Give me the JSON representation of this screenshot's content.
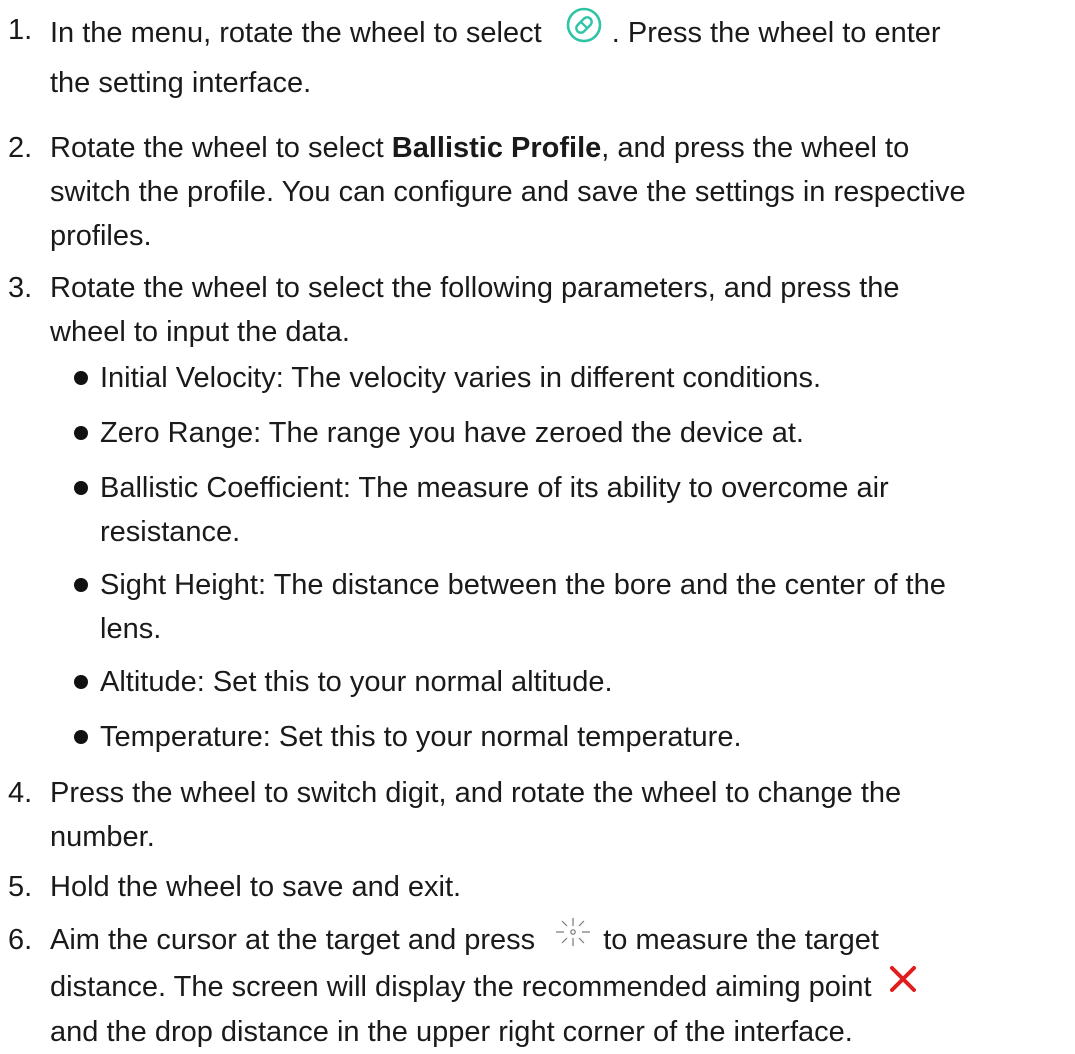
{
  "steps": [
    {
      "num": "1.",
      "a": "In the menu, rotate the wheel to select",
      "b": ". Press the wheel to enter",
      "c": "the setting interface.",
      "icon": "ballistic-settings-icon"
    },
    {
      "num": "2.",
      "a": "Rotate the wheel to select",
      "bold": "Ballistic Profile",
      "b": ", and press the wheel to",
      "c": "switch the profile. You can configure and save the settings in respective",
      "d": "profiles."
    },
    {
      "num": "3.",
      "a": "Rotate the wheel to select the following parameters, and press the",
      "b": "wheel to input the data."
    },
    {
      "num": "4.",
      "a": "Press the wheel to switch digit, and rotate the wheel to change the",
      "b": "number."
    },
    {
      "num": "5.",
      "a": "Hold the wheel to save and exit."
    },
    {
      "num": "6.",
      "a": "Aim the cursor at the target and press",
      "b": "to measure the target",
      "c": "distance. The screen will display the recommended aiming point",
      "d": "and the drop distance in the upper right corner of the interface.",
      "icon1": "laser-ranging-icon",
      "icon2": "aiming-point-x-icon"
    }
  ],
  "bullets": [
    {
      "l1": "Initial Velocity: The velocity varies in different conditions."
    },
    {
      "l1": "Zero Range: The range you have zeroed the device at."
    },
    {
      "l1": "Ballistic Coefficient: The measure of its ability to overcome air",
      "l2": "resistance."
    },
    {
      "l1": "Sight Height: The distance between the bore and the center of the",
      "l2": "lens."
    },
    {
      "l1": "Altitude: Set this to your normal altitude."
    },
    {
      "l1": "Temperature: Set this to your normal temperature."
    }
  ],
  "colors": {
    "accent_teal": "#2ec4a6",
    "accent_red": "#e11d1d",
    "text": "#1a1a1a"
  }
}
